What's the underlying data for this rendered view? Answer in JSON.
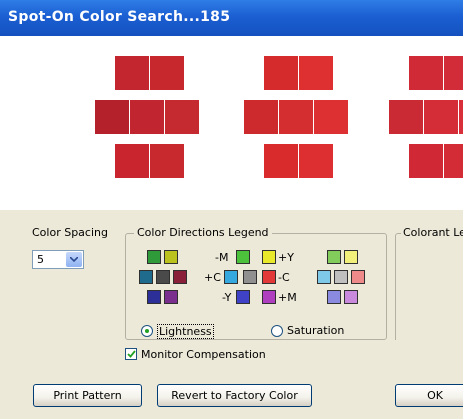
{
  "window": {
    "title": "Spot-On Color Search...185"
  },
  "swatch_groups": [
    {
      "colors": [
        "#c3262f",
        "#c6282e",
        "#b5212b",
        "#c12630",
        "#c62a31",
        "#c9252f",
        "#c7292e"
      ]
    },
    {
      "colors": [
        "#d62b2c",
        "#de3030",
        "#cc2a2d",
        "#d52e30",
        "#dc3032",
        "#d92a2c",
        "#dd2e31"
      ]
    },
    {
      "colors": [
        "#cf2a35",
        "#d22c39",
        "#c92a33",
        "#d52d38",
        "#d82f3a",
        "#d02834",
        "#d32c37"
      ]
    }
  ],
  "controls": {
    "color_spacing_label": "Color Spacing",
    "color_spacing_value": "5",
    "legend_title": "Color Directions Legend",
    "colorant_label": "Colorant Le",
    "lightness_label": "Lightness",
    "saturation_label": "Saturation",
    "mode_selected": "Lightness",
    "monitor_comp_label": "Monitor Compensation",
    "monitor_comp_checked": true
  },
  "legend": {
    "minus_m": "-M",
    "plus_y": "+Y",
    "plus_c": "+C",
    "minus_c": "-C",
    "minus_y": "-Y",
    "plus_m": "+M",
    "colors": {
      "g1_top": [
        "#2f9a3a",
        "#bcc21d"
      ],
      "g1_mid": [
        "#1f6b8e",
        "#4a4a4a",
        "#8a1f3a"
      ],
      "g1_bot": [
        "#2d2f99",
        "#7a2e8e"
      ],
      "g2_top": [
        "#4cc23c",
        "#e9e92b"
      ],
      "g2_mid": [
        "#36a8e0",
        "#909090",
        "#e33838"
      ],
      "g2_bot": [
        "#3f42c6",
        "#b03fc0"
      ],
      "g3_top": [
        "#82cc5c",
        "#f0f07a"
      ],
      "g3_mid": [
        "#7ec8e8",
        "#bfbfbf",
        "#ee8a8a"
      ],
      "g3_bot": [
        "#8a8be0",
        "#c98ade"
      ]
    }
  },
  "buttons": {
    "print": "Print Pattern",
    "revert": "Revert to Factory Color",
    "ok": "OK"
  }
}
